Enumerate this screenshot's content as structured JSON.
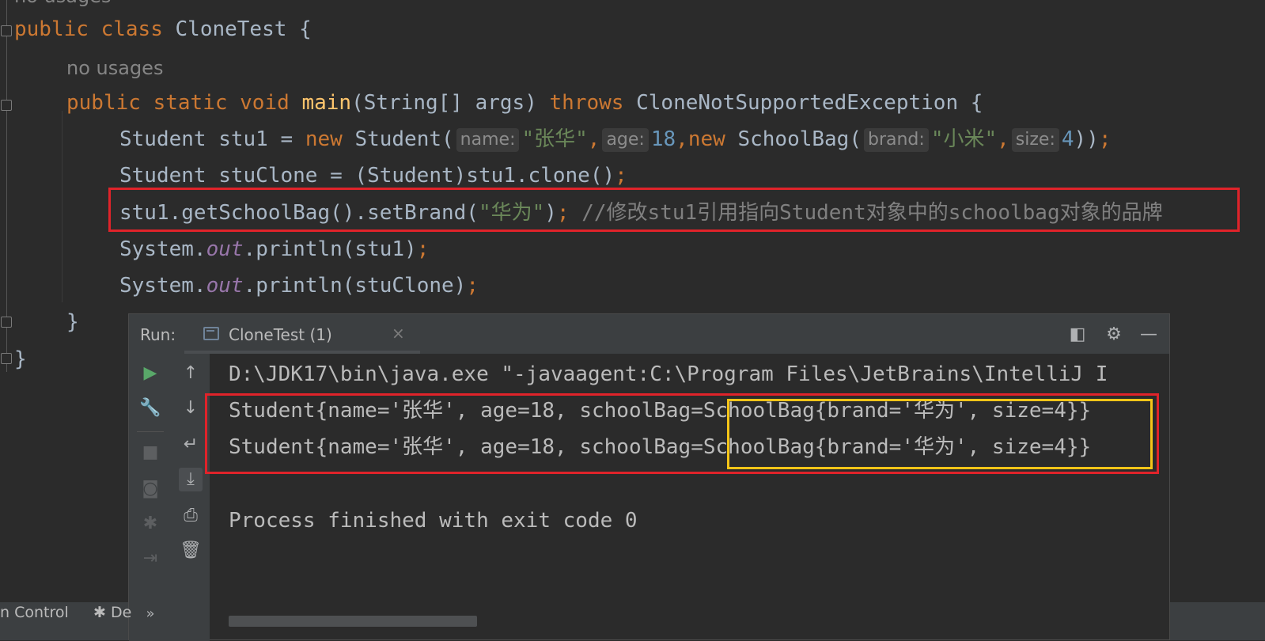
{
  "editor": {
    "top_hint": "no usages",
    "class_hint": "no usages",
    "line_class": {
      "kw1": "public",
      "kw2": "class",
      "name": "CloneTest",
      "brace": "{"
    },
    "line_main": {
      "kw1": "public",
      "kw2": "static",
      "kw3": "void",
      "fn": "main",
      "params": "(String[] args)",
      "throws": "throws",
      "exc": "CloneNotSupportedException",
      "brace": "{"
    },
    "line_stu1": {
      "pre": "Student stu1 = ",
      "new1": "new",
      "cls1": "Student(",
      "hint_name": "name:",
      "str_name": "\"张华\"",
      "comma1": ",",
      "hint_age": "age:",
      "num_age": "18",
      "comma2": ",",
      "new2": "new",
      "cls2": "SchoolBag(",
      "hint_brand": "brand:",
      "str_brand": "\"小米\"",
      "comma3": ",",
      "hint_size": "size:",
      "num_size": "4",
      "close": "))",
      "semi": ";"
    },
    "line_clone": {
      "code": "Student stuClone = (Student)stu1.clone()",
      "semi": ";"
    },
    "line_setbrand": {
      "code": "stu1.getSchoolBag().setBrand(",
      "str": "\"华为\"",
      "close": ")",
      "semi": ";",
      "comment": " //修改stu1引用指向Student对象中的schoolbag对象的品牌"
    },
    "line_print1": {
      "pre": "System.",
      "field": "out",
      "post": ".println(stu1)",
      "semi": ";"
    },
    "line_print2": {
      "pre": "System.",
      "field": "out",
      "post": ".println(stuClone)",
      "semi": ";"
    },
    "close_method": "}",
    "close_class": "}"
  },
  "run_panel": {
    "label": "Run:",
    "tab_title": "CloneTest (1)",
    "tab_close": "×",
    "console": [
      "D:\\JDK17\\bin\\java.exe \"-javaagent:C:\\Program Files\\JetBrains\\IntelliJ I",
      "Student{name='张华', age=18, schoolBag=SchoolBag{brand='华为', size=4}}",
      "Student{name='张华', age=18, schoolBag=SchoolBag{brand='华为', size=4}}",
      "",
      "Process finished with exit code 0"
    ]
  },
  "status_bar": {
    "version_control": "n Control",
    "debug": "De",
    "more": "»"
  },
  "colors": {
    "highlight_red": "#e0232a",
    "highlight_yellow": "#f5c518",
    "run_green": "#59a869"
  }
}
